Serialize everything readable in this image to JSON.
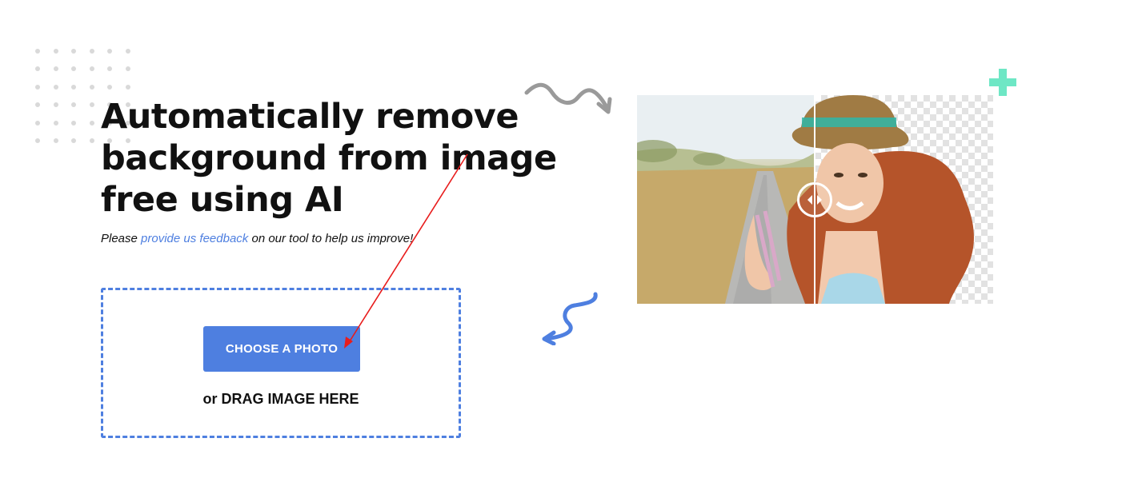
{
  "hero": {
    "title_line1": "Automatically remove",
    "title_line2": "background from image",
    "title_line3": "free using AI"
  },
  "feedback": {
    "prefix": "Please ",
    "link_text": "provide us feedback",
    "suffix": " on our tool to help us improve!"
  },
  "upload": {
    "button_label": "CHOOSE A PHOTO",
    "drag_text": "or DRAG IMAGE HERE"
  },
  "preview": {
    "slider_position": 0.5
  },
  "decorations": {
    "dot_grid": "dot-grid-decoration",
    "gray_arrow": "squiggle-arrow-right-icon",
    "blue_arrow": "squiggle-arrow-left-icon",
    "plus": "plus-icon",
    "annotation_arrow": "red-annotation-arrow"
  },
  "colors": {
    "accent": "#4e7fe0",
    "plus": "#6ee7c5",
    "annotation": "#e81c1c",
    "squiggle_gray": "#9a9a9a"
  }
}
